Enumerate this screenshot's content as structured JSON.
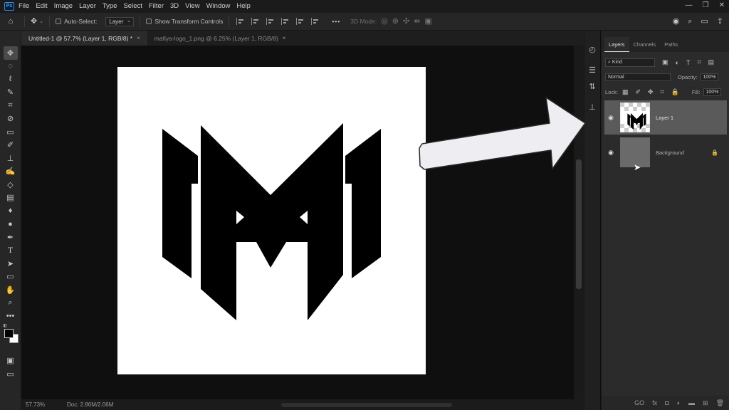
{
  "menubar": {
    "app_logo": "Ps",
    "items": [
      "File",
      "Edit",
      "Image",
      "Layer",
      "Type",
      "Select",
      "Filter",
      "3D",
      "View",
      "Window",
      "Help"
    ],
    "window_controls": [
      "—",
      "❐",
      "✕"
    ]
  },
  "options_bar": {
    "home_icon": "home-icon",
    "move_icon": "move-icon",
    "auto_select_label": "Auto-Select:",
    "auto_select_value": "Layer",
    "transform_controls_label": "Show Transform Controls",
    "more_label": "•••",
    "mode_3d_label": "3D Mode:"
  },
  "tabs": [
    {
      "label": "Untitled-1 @ 57.7% (Layer 1, RGB/8) *",
      "close": "×"
    },
    {
      "label": "mafiya-logo_1.png @ 6.25% (Layer 1, RGB/8)",
      "close": "×"
    }
  ],
  "toolbar": {
    "tools": [
      "move-tool",
      "ellipse-marquee-tool",
      "lasso-tool",
      "quick-selection-tool",
      "crop-tool",
      "eyedropper-tool",
      "healing-brush-tool",
      "brush-tool",
      "clone-stamp-tool",
      "history-brush-tool",
      "eraser-tool",
      "gradient-tool",
      "blur-tool",
      "dodge-tool",
      "pen-tool",
      "type-tool",
      "path-selection-tool",
      "rectangle-tool",
      "hand-tool",
      "zoom-tool",
      "more-tools"
    ],
    "more_label": "•••",
    "foreground_color": "#000000",
    "background_color": "#ffffff"
  },
  "status": {
    "zoom": "57.73%",
    "doc": "Doc: 2.86M/2.06M"
  },
  "layers_panel": {
    "tabs": [
      "Layers",
      "Channels",
      "Paths"
    ],
    "filter_label": "Kind",
    "blend_mode": "Normal",
    "opacity_label": "Opacity:",
    "opacity_value": "100%",
    "lock_label": "Lock:",
    "fill_label": "Fill:",
    "fill_value": "100%",
    "layers": [
      {
        "name": "Layer 1",
        "selected": true,
        "visible": true
      },
      {
        "name": "Background",
        "selected": false,
        "visible": true,
        "locked": true,
        "thumb_color": "#6a6a6a"
      }
    ],
    "footer_icons": [
      "link-icon",
      "fx-icon",
      "mask-icon",
      "adjustment-icon",
      "group-icon",
      "new-layer-icon",
      "delete-icon"
    ],
    "footer_labels": [
      "GO",
      "fx",
      "◘",
      "◐",
      "▬",
      "⊞",
      "🗑"
    ]
  },
  "colors": {
    "accent": "#31a8ff",
    "canvas_bg": "#0f0f0f",
    "panel_bg": "#2b2b2b",
    "arrow_fill": "#eeeef2"
  }
}
